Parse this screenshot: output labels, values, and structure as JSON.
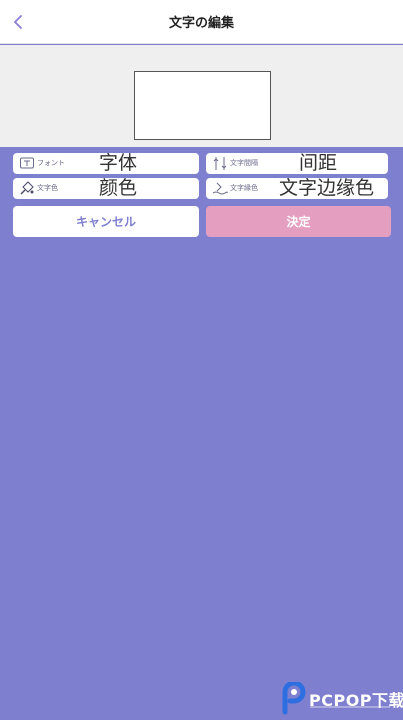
{
  "header": {
    "title": "文字の編集",
    "back_icon": "chevron-left-icon"
  },
  "options": {
    "font": {
      "label": "フォント",
      "value": "字体",
      "icon": "font-box-icon"
    },
    "spacing": {
      "label": "文字間隔",
      "value": "间距",
      "icon": "spacing-icon"
    },
    "text_color": {
      "label": "文字色",
      "value": "颜色",
      "icon": "paint-bucket-icon"
    },
    "outline_color": {
      "label": "文字縁色",
      "value": "文字边缘色",
      "icon": "outline-wave-icon"
    }
  },
  "actions": {
    "cancel_label": "キャンセル",
    "confirm_label": "決定"
  },
  "watermark": {
    "text": "PCPOP下载",
    "logo": "pcpop-logo"
  },
  "colors": {
    "background": "#7f7fd0",
    "accent": "#7f7fd0",
    "confirm": "#e39ec0",
    "preview_bg": "#efefef"
  }
}
